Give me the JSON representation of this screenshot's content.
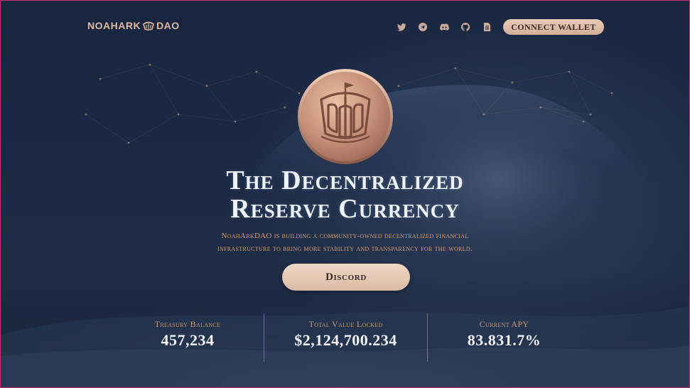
{
  "header": {
    "logo_left": "NOAHARK",
    "logo_right": "DAO",
    "socials": [
      {
        "name": "twitter-icon"
      },
      {
        "name": "telegram-icon"
      },
      {
        "name": "discord-icon"
      },
      {
        "name": "github-icon"
      },
      {
        "name": "docs-icon"
      }
    ],
    "connect_label": "CONNECT WALLET"
  },
  "hero": {
    "title_line1": "The Decentralized",
    "title_line2": "Reserve Currency",
    "subtitle_line1": "NoahArkDAO is building a community-owned decentralized financial",
    "subtitle_line2": "infrastructure to bring more stability and transparency for the world.",
    "cta_label": "Discord"
  },
  "stats": [
    {
      "label": "Treasury Balance",
      "value": "457,234"
    },
    {
      "label": "Total Value Locked",
      "value": "$2,124,700.234"
    },
    {
      "label": "Current APY",
      "value": "83.831.7%"
    }
  ],
  "colors": {
    "accent": "#dcb49a",
    "gold_text": "#d9a070",
    "background": "#1b2944",
    "border": "#c8356e"
  }
}
